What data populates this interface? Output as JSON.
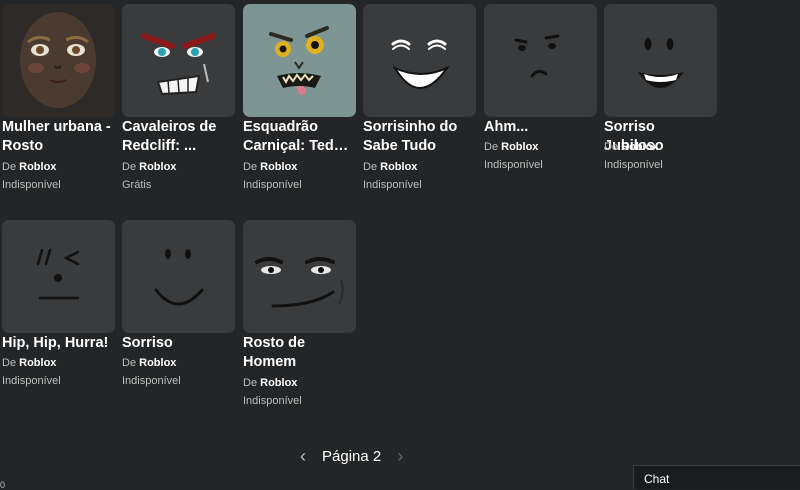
{
  "items": [
    {
      "name": "Mulher urbana - Rosto",
      "by": "De",
      "creator": "Roblox",
      "price": "Indisponível",
      "icon": "urban-woman-face-icon"
    },
    {
      "name": "Cavaleiros de Redcliff: ...",
      "by": "De",
      "creator": "Roblox",
      "price": "Grátis",
      "icon": "redcliff-knight-face-icon"
    },
    {
      "name": "Esquadrão Carniçal: Tedd, ...",
      "by": "De",
      "creator": "Roblox",
      "price": "Indisponível",
      "icon": "ghoul-face-icon"
    },
    {
      "name": "Sorrisinho do Sabe Tudo",
      "by": "De",
      "creator": "Roblox",
      "price": "Indisponível",
      "icon": "smug-smile-face-icon"
    },
    {
      "name": "Ahm...",
      "by": "De",
      "creator": "Roblox",
      "price": "Indisponível",
      "icon": "uncertain-face-icon"
    },
    {
      "name": "Sorriso Jubiloso",
      "by": "De",
      "creator": "Roblox",
      "price": "Indisponível",
      "icon": "joyful-smile-face-icon"
    },
    {
      "name": "Hip, Hip, Hurra!",
      "by": "De",
      "creator": "Roblox",
      "price": "Indisponível",
      "icon": "wink-face-icon"
    },
    {
      "name": "Sorriso",
      "by": "De",
      "creator": "Roblox",
      "price": "Indisponível",
      "icon": "smile-face-icon"
    },
    {
      "name": "Rosto de Homem",
      "by": "De",
      "creator": "Roblox",
      "price": "Indisponível",
      "icon": "man-face-icon"
    }
  ],
  "pagination": {
    "label": "Página 2",
    "prev": "‹",
    "next": "›"
  },
  "chat": {
    "label": "Chat"
  },
  "corner_text": "0"
}
